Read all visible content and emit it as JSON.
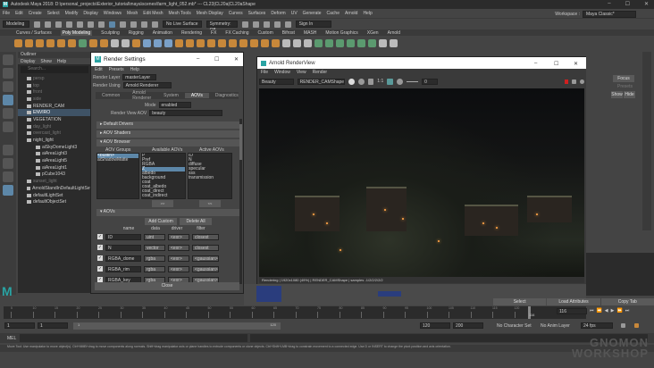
{
  "app": {
    "title": "Autodesk Maya 2018: D:\\personal_projects\\Exterior_tutorial\\maya\\scenes\\farm_light_052.mb*  ---  CL23|CL20a|CL20aShape",
    "menus": [
      "File",
      "Edit",
      "Create",
      "Select",
      "Modify",
      "Display",
      "Windows",
      "Mesh",
      "Edit Mesh",
      "Mesh Tools",
      "Mesh Display",
      "Curves",
      "Surfaces",
      "Deform",
      "UV",
      "Generate",
      "Cache",
      "Arnold",
      "Help"
    ],
    "workspace_label": "Workspace :",
    "workspace_value": "Maya Classic*"
  },
  "status_line": {
    "mode": "Modeling",
    "live_surface": "No Live Surface",
    "symmetry": "Symmetry: Off",
    "sign_in": "Sign In"
  },
  "shelf_tabs": [
    "Curves / Surfaces",
    "Poly Modeling",
    "Sculpting",
    "Rigging",
    "Animation",
    "Rendering",
    "FX",
    "FX Caching",
    "Custom",
    "Bifrost",
    "MASH",
    "Motion Graphics",
    "XGen",
    "Arnold"
  ],
  "shelf_active": "Poly Modeling",
  "outliner": {
    "title": "Outliner",
    "menus": [
      "Display",
      "Show",
      "Help"
    ],
    "search_placeholder": "Search...",
    "items": [
      {
        "label": "persp",
        "state": "dim"
      },
      {
        "label": "top",
        "state": "dim"
      },
      {
        "label": "front",
        "state": "dim"
      },
      {
        "label": "side",
        "state": "dim"
      },
      {
        "label": "RENDER_CAM",
        "state": "normal"
      },
      {
        "label": "ENVIRO",
        "state": "selected"
      },
      {
        "label": "VEGETATION",
        "state": "normal"
      },
      {
        "label": "day_light",
        "state": "dim"
      },
      {
        "label": "overcast_light",
        "state": "dim"
      },
      {
        "label": "night_light",
        "state": "normal"
      },
      {
        "label": "aiSkyDomeLight3",
        "state": "normal"
      },
      {
        "label": "aiAreaLight3",
        "state": "normal"
      },
      {
        "label": "aiAreaLight5",
        "state": "normal"
      },
      {
        "label": "aiAreaLight1",
        "state": "normal"
      },
      {
        "label": "pCube1043",
        "state": "normal"
      },
      {
        "label": "sunset_light",
        "state": "dim"
      },
      {
        "label": "ArnoldStandInDefaultLightSet",
        "state": "normal"
      },
      {
        "label": "defaultLightSet",
        "state": "normal"
      },
      {
        "label": "defaultObjectSet",
        "state": "normal"
      }
    ]
  },
  "render_settings": {
    "title": "Render Settings",
    "menus": [
      "Edit",
      "Presets",
      "Help"
    ],
    "render_layer_label": "Render Layer",
    "render_layer": "masterLayer",
    "render_using_label": "Render Using",
    "render_using": "Arnold Renderer",
    "tabs": [
      "Common",
      "Arnold Renderer",
      "System",
      "AOVs",
      "Diagnostics"
    ],
    "active_tab": "AOVs",
    "mode_label": "Mode",
    "mode": "enabled",
    "rv_aov_label": "Render View AOV",
    "rv_aov": "beauty",
    "sections": [
      "Default Drivers",
      "AOV Shaders",
      "AOV Browser"
    ],
    "aov_groups_label": "AOV Groups",
    "aov_groups": [
      "<builtin>",
      "aiShadowMatte"
    ],
    "available_label": "Available AOVs",
    "available": [
      "P",
      "Pref",
      "RGBA",
      "Z",
      "albedo",
      "background",
      "coat",
      "coat_albedo",
      "coat_direct",
      "coat_indirect"
    ],
    "available_selected": "Z",
    "active_label": "Active AOVs",
    "active": [
      "ID",
      "N",
      "diffuse",
      "specular",
      "sss",
      "transmission"
    ],
    "add_arrow": ">>",
    "remove_arrow": "<<",
    "aovs_section": "AOVs",
    "add_custom": "Add Custom",
    "delete_all": "Delete All",
    "columns": [
      "name",
      "data",
      "driver",
      "filter"
    ],
    "rows": [
      {
        "name": "ID",
        "data": "uint",
        "driver": "<exr>",
        "filter": "closest"
      },
      {
        "name": "N",
        "data": "vector",
        "driver": "<exr>",
        "filter": "closest"
      },
      {
        "name": "RGBA_dome",
        "data": "rgba",
        "driver": "<exr>",
        "filter": "<gaussian>"
      },
      {
        "name": "RGBA_rim",
        "data": "rgba",
        "driver": "<exr>",
        "filter": "<gaussian>"
      },
      {
        "name": "RGBA_key",
        "data": "rgba",
        "driver": "<exr>",
        "filter": "<gaussian>"
      }
    ],
    "close": "Close"
  },
  "arnold_renderview": {
    "title": "Arnold RenderView",
    "menus": [
      "File",
      "Window",
      "View",
      "Render"
    ],
    "aov": "Beauty",
    "camera": "RENDER_CAMShape",
    "ratio": "1:1",
    "exposure": "0",
    "status": "Rendering | 1920x1080 (49%) | RENDER_CAMShape | samples -1/2/2/2/2/2"
  },
  "channel_box": {
    "focus": "Focus",
    "presets": "Presets",
    "show": "Show",
    "hide": "Hide",
    "select": "Select",
    "load_attributes": "Load Attributes",
    "copy_tab": "Copy Tab"
  },
  "timeline": {
    "ticks": [
      "5",
      "10",
      "15",
      "20",
      "25",
      "30",
      "35",
      "40",
      "45",
      "50",
      "55",
      "60",
      "65",
      "70",
      "75",
      "80",
      "85",
      "90",
      "95",
      "100",
      "105",
      "110",
      "115",
      "120"
    ],
    "current_frame": "116",
    "current_field": "116"
  },
  "range": {
    "start": "1",
    "start2": "1",
    "slider_start": "1",
    "slider_end": "120",
    "end": "120",
    "end2": "200",
    "character_set": "No Character Set",
    "anim_layer": "No Anim Layer",
    "fps": "24 fps"
  },
  "mel": {
    "label": "MEL"
  },
  "help_line": "Move Tool: Use manipulator to move object(s). Ctrl+MMB+drag to move components along normals. Shift+drag manipulator axis or plane handles to extrude components or clone objects. Ctrl+Shift+LMB+drag to constrain movement to a connected edge. Use D or INSERT to change the pivot position and axis orientation.",
  "watermark": "THE GNOMON WORKSHOP",
  "colors": {
    "selection": "#5d87a8",
    "maya_teal": "#29a3a3",
    "record": "#d02020"
  }
}
